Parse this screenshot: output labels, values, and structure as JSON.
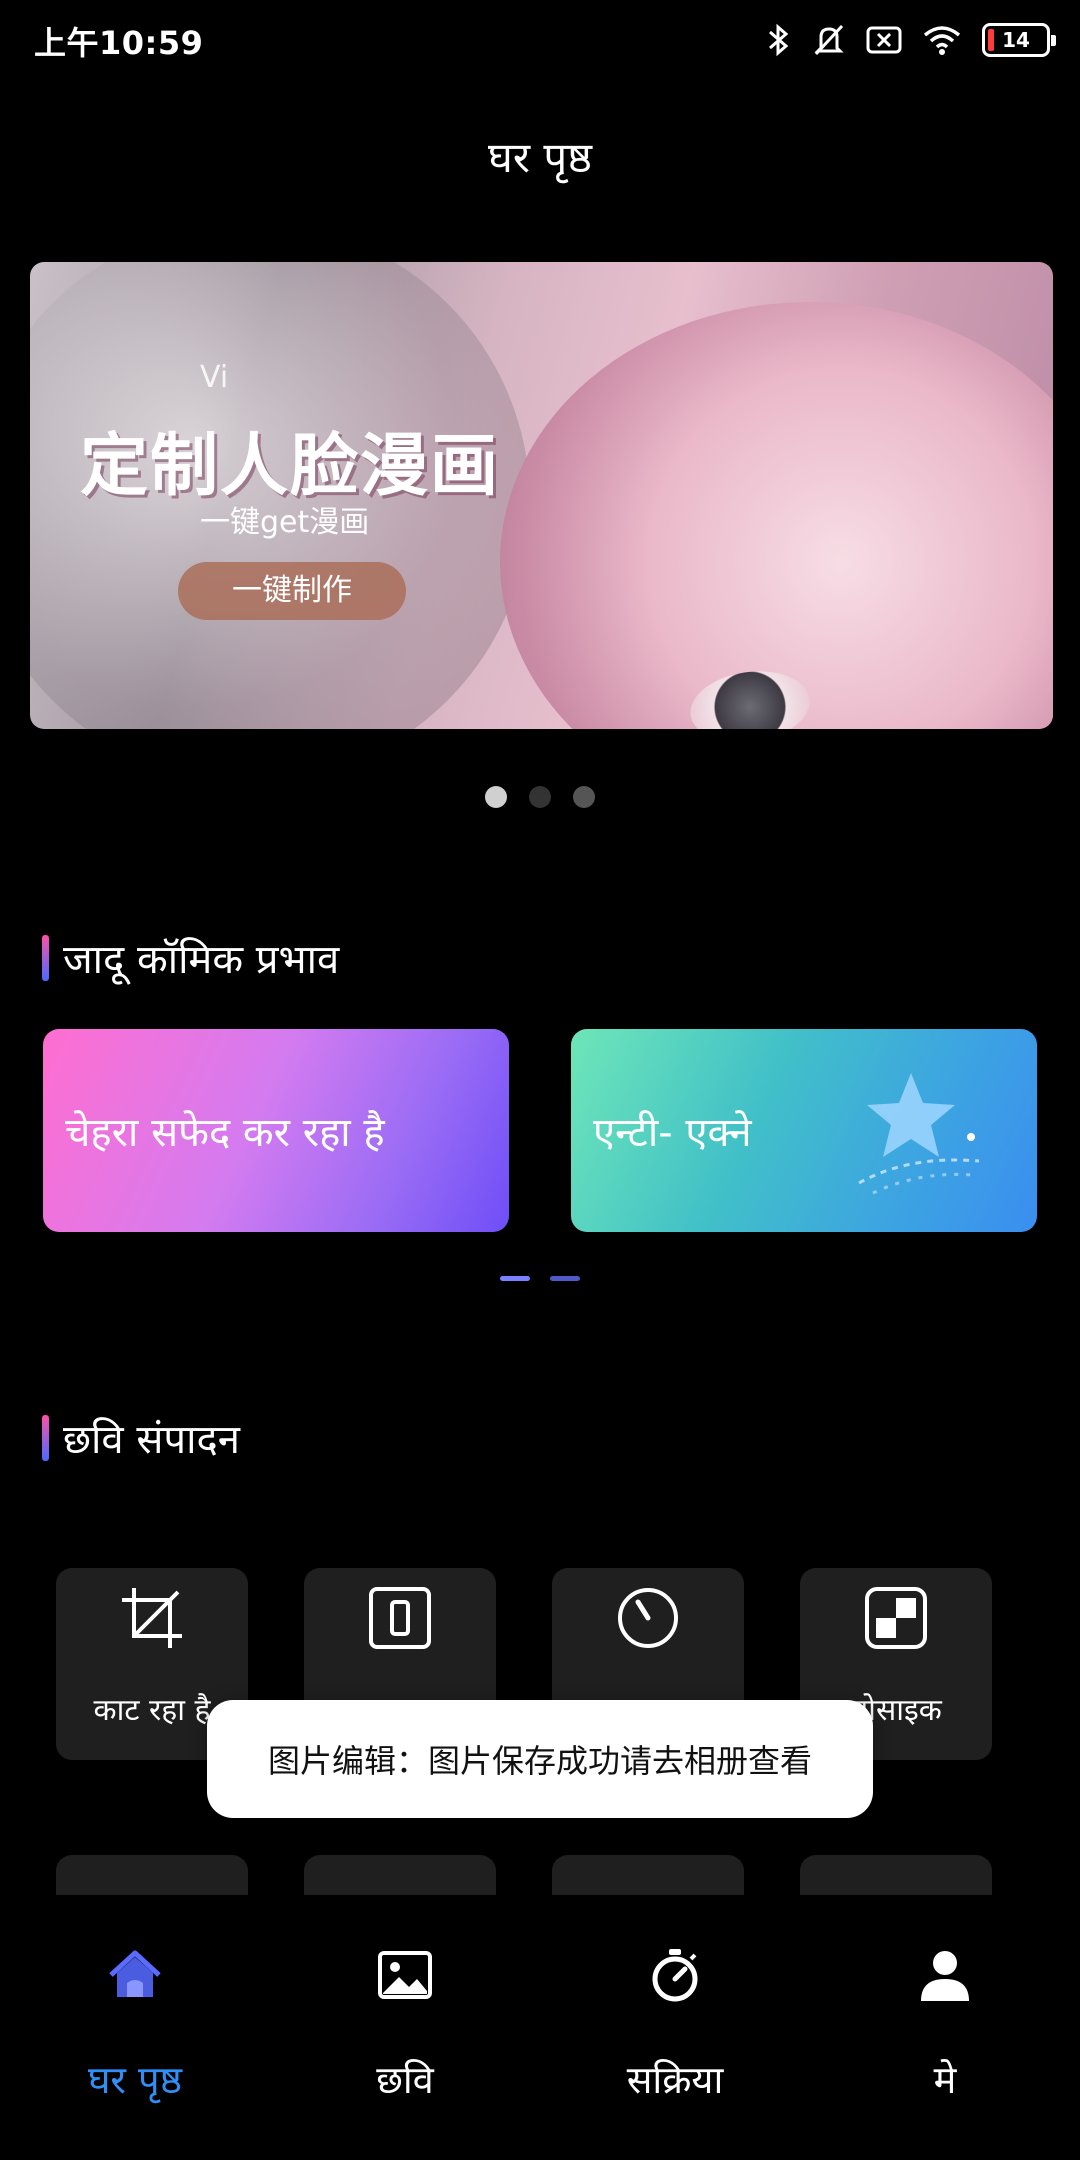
{
  "status_bar": {
    "time": "上午10:59",
    "battery": "14"
  },
  "header": {
    "title": "घर पृष्ठ"
  },
  "banner": {
    "subtitle_top": "Vi",
    "title": "定制人脸漫画",
    "subtitle": "一键get漫画",
    "button": "一键制作",
    "page_count": 3,
    "active_page": 0
  },
  "section_comic": {
    "title": "जादू कॉमिक प्रभाव",
    "cards": [
      {
        "label": "चेहरा सफेद कर रहा है",
        "colors": [
          "#ff6ed0",
          "#6f4ef7"
        ]
      },
      {
        "label": "एन्टी- एक्ने",
        "colors": [
          "#6ee6b8",
          "#3a8ef0"
        ]
      }
    ]
  },
  "section_edit": {
    "title": "छवि संपादन",
    "tools": [
      {
        "label": "काट रहा है",
        "icon": "crop-icon"
      },
      {
        "label": "",
        "icon": "aspect-ratio-icon"
      },
      {
        "label": "",
        "icon": "speedometer-icon"
      },
      {
        "label": "मोसाइक",
        "icon": "mosaic-icon"
      }
    ]
  },
  "toast": {
    "text": "图片编辑：图片保存成功请去相册查看"
  },
  "bottom_nav": {
    "items": [
      {
        "label": "घर पृष्ठ",
        "icon": "home-icon",
        "active": true
      },
      {
        "label": "छवि",
        "icon": "image-icon",
        "active": false
      },
      {
        "label": "सक्रिया",
        "icon": "stopwatch-icon",
        "active": false
      },
      {
        "label": "मे",
        "icon": "person-icon",
        "active": false
      }
    ]
  },
  "colors": {
    "accent": "#2f8ff7",
    "background": "#000000",
    "tile": "#1f1f1f"
  }
}
